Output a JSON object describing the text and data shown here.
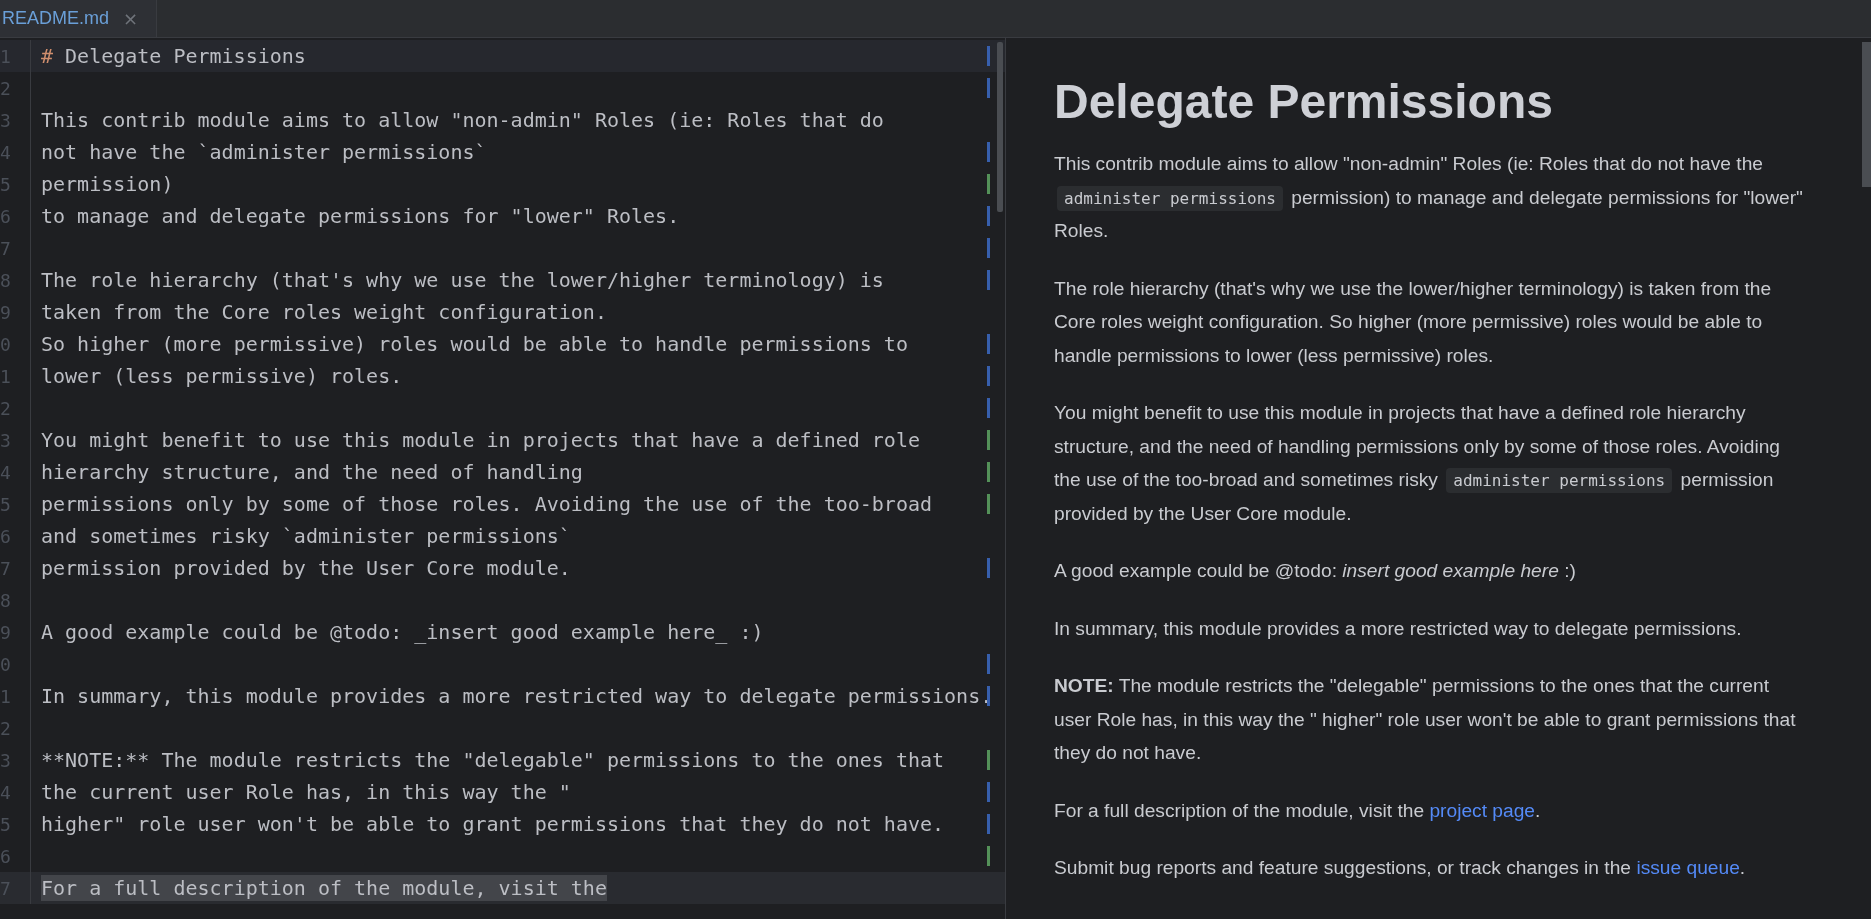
{
  "tabs": [
    {
      "label": "README.md",
      "selected": true,
      "close": "×"
    }
  ],
  "editor": {
    "lines": [
      {
        "number": "1",
        "prefix": "#",
        "text": "Delegate Permissions",
        "color": "#375fad",
        "current": true,
        "selected": false
      },
      {
        "number": "2",
        "color": "#375fad",
        "current": false,
        "selected": false
      },
      {
        "number": "3",
        "text": "This contrib module aims to allow \"non-admin\" Roles (ie: Roles that do",
        "current": false,
        "selected": false
      },
      {
        "number": "4",
        "text": "not have the `administer permissions`",
        "color": "#375fad",
        "current": false,
        "selected": false
      },
      {
        "number": "5",
        "text": "permission)",
        "color": "#549159",
        "current": false,
        "selected": false
      },
      {
        "number": "6",
        "text": "to manage and delegate permissions for \"lower\" Roles.",
        "color": "#375fad",
        "current": false,
        "selected": false
      },
      {
        "number": "7",
        "color": "#375fad",
        "current": false,
        "selected": false
      },
      {
        "number": "8",
        "text": "The role hierarchy (that's why we use the lower/higher terminology) is",
        "color": "#375fad",
        "current": false,
        "selected": false
      },
      {
        "number": "9",
        "text": "taken from the Core roles weight configuration.",
        "current": false,
        "selected": false
      },
      {
        "number": "0",
        "text": "So higher (more permissive) roles would be able to handle permissions to",
        "color": "#375fad",
        "current": false,
        "selected": false
      },
      {
        "number": "1",
        "text": "lower (less permissive) roles.",
        "color": "#375fad",
        "current": false,
        "selected": false
      },
      {
        "number": "2",
        "color": "#375fad",
        "current": false,
        "selected": false
      },
      {
        "number": "3",
        "text": "You might benefit to use this module in projects that have a defined role",
        "color": "#549159",
        "current": false,
        "selected": false
      },
      {
        "number": "4",
        "text": "hierarchy structure, and the need of handling",
        "color": "#549159",
        "current": false,
        "selected": false
      },
      {
        "number": "5",
        "text": "permissions only by some of those roles. Avoiding the use of the too-broad",
        "color": "#549159",
        "current": false,
        "selected": false
      },
      {
        "number": "6",
        "text": "and sometimes risky `administer permissions`",
        "current": false,
        "selected": false
      },
      {
        "number": "7",
        "text": "permission provided by the User Core module.",
        "color": "#375fad",
        "current": false,
        "selected": false
      },
      {
        "number": "8",
        "current": false,
        "selected": false
      },
      {
        "number": "9",
        "text": "A good example could be @todo: _insert good example here_ :)",
        "current": false,
        "selected": false
      },
      {
        "number": "0",
        "color": "#375fad",
        "current": false,
        "selected": false
      },
      {
        "number": "1",
        "text": "In summary, this module provides a more restricted way to delegate permissions.",
        "color": "#375fad",
        "current": false,
        "selected": false
      },
      {
        "number": "2",
        "current": false,
        "selected": false
      },
      {
        "number": "3",
        "text": "**NOTE:** The module restricts the \"delegable\" permissions to the ones that",
        "color": "#549159",
        "current": false,
        "selected": false
      },
      {
        "number": "4",
        "text": "the current user Role has, in this way the \"",
        "color": "#375fad",
        "current": false,
        "selected": false
      },
      {
        "number": "5",
        "text": "higher\" role user won't be able to grant permissions that they do not have.",
        "color": "#375fad",
        "current": false,
        "selected": false
      },
      {
        "number": "6",
        "color": "#549159",
        "current": false,
        "selected": false
      },
      {
        "number": "7",
        "text": "For a full description of the module, visit the",
        "current": false,
        "selected": true
      }
    ]
  },
  "preview": {
    "title": "Delegate Permissions",
    "paragraphs": [
      [
        {
          "kind": "text",
          "text": "This contrib module aims to allow \"non-admin\" Roles (ie: Roles that do not have the "
        },
        {
          "kind": "code",
          "text": "administer permissions"
        },
        {
          "kind": "text",
          "text": " permission) to manage and delegate permissions for \"lower\" Roles."
        }
      ],
      [
        {
          "kind": "text",
          "text": "The role hierarchy (that's why we use the lower/higher terminology) is taken from the Core roles weight configuration. So higher (more permissive) roles would be able to handle permissions to lower (less permissive) roles."
        }
      ],
      [
        {
          "kind": "text",
          "text": "You might benefit to use this module in projects that have a defined role hierarchy structure, and the need of handling permissions only by some of those roles. Avoiding the use of the too-broad and sometimes risky "
        },
        {
          "kind": "code",
          "text": "administer permissions"
        },
        {
          "kind": "text",
          "text": " permission provided by the User Core module."
        }
      ],
      [
        {
          "kind": "text",
          "text": "A good example could be @todo: "
        },
        {
          "kind": "italic",
          "text": "insert good example here"
        },
        {
          "kind": "text",
          "text": " :)"
        }
      ],
      [
        {
          "kind": "text",
          "text": "In summary, this module provides a more restricted way to delegate permissions."
        }
      ],
      [
        {
          "kind": "bold",
          "text": "NOTE:"
        },
        {
          "kind": "text",
          "text": " The module restricts the \"delegable\" permissions to the ones that the current user Role has, in this way the \" higher\" role user won't be able to grant permissions that they do not have."
        }
      ],
      [
        {
          "kind": "text",
          "text": "For a full description of the module, visit the "
        },
        {
          "kind": "link",
          "text": "project page"
        },
        {
          "kind": "text",
          "text": "."
        }
      ],
      [
        {
          "kind": "text",
          "text": "Submit bug reports and feature suggestions, or track changes in the "
        },
        {
          "kind": "link",
          "text": "issue queue"
        },
        {
          "kind": "text",
          "text": "."
        }
      ]
    ]
  }
}
